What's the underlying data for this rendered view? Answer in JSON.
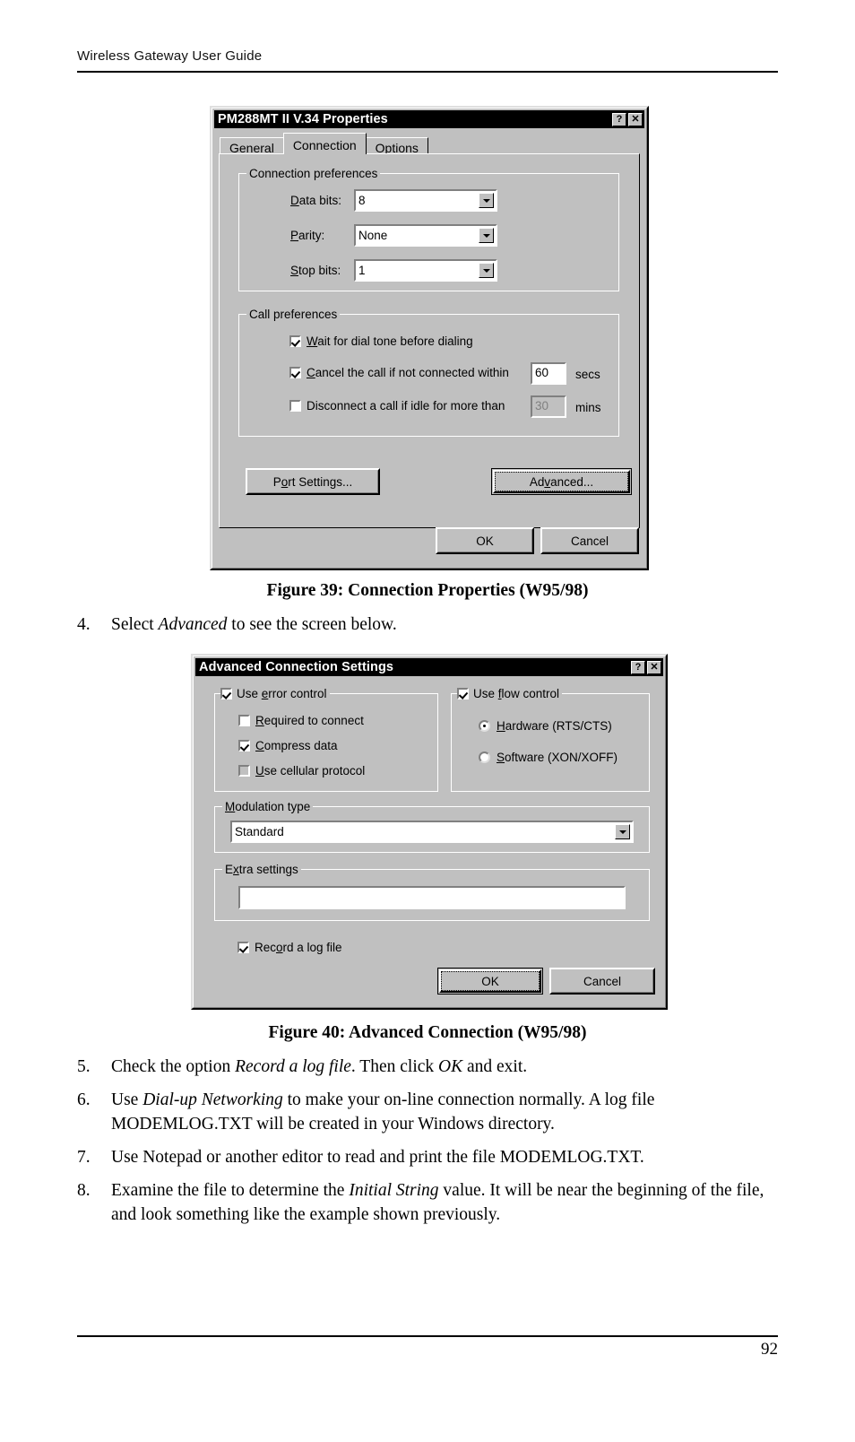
{
  "page": {
    "header": "Wireless Gateway User Guide",
    "number": "92"
  },
  "figure39": {
    "caption": "Figure 39: Connection Properties (W95/98)",
    "dialog": {
      "title": "PM288MT II V.34 Properties",
      "title_buttons": {
        "help": "?",
        "close": "✕"
      },
      "tabs": [
        {
          "label": "General",
          "active": false
        },
        {
          "label": "Connection",
          "active": true
        },
        {
          "label": "Options",
          "active": false
        }
      ],
      "connection_preferences": {
        "title": "Connection preferences",
        "fields": [
          {
            "label_pre": "D",
            "label_post": "ata bits:",
            "value": "8"
          },
          {
            "label_pre": "P",
            "label_post": "arity:",
            "value": "None"
          },
          {
            "label_pre": "S",
            "label_post": "top bits:",
            "value": "1"
          }
        ]
      },
      "call_preferences": {
        "title": "Call preferences",
        "wait": {
          "pre": "W",
          "post": "ait for dial tone before dialing",
          "checked": true
        },
        "cancel": {
          "pre": "C",
          "post": "ancel the call if not connected within",
          "checked": true,
          "value": "60",
          "unit": "secs"
        },
        "disconnect": {
          "pre": "Di",
          "post": "sconnect a call if idle for more than",
          "checked": false,
          "value": "30",
          "unit": "mins"
        }
      },
      "buttons": {
        "port_settings": {
          "pre": "P",
          "mid": "o",
          "post": "rt Settings..."
        },
        "advanced": {
          "pre": "Ad",
          "mid": "v",
          "post": "anced..."
        },
        "ok": "OK",
        "cancel": "Cancel"
      }
    }
  },
  "step4": {
    "num": "4.",
    "pre": "Select ",
    "em": "Advanced",
    "post": " to see the screen below."
  },
  "figure40": {
    "caption": "Figure 40: Advanced Connection (W95/98)",
    "dialog": {
      "title": "Advanced Connection Settings",
      "title_buttons": {
        "help": "?",
        "close": "✕"
      },
      "error_control": {
        "title_pre": "Use ",
        "title_mid": "e",
        "title_post": "rror control",
        "checked": true,
        "options": [
          {
            "pre": "R",
            "post": "equired to connect",
            "checked": false,
            "disabled": false
          },
          {
            "pre": "C",
            "post": "ompress data",
            "checked": true,
            "disabled": false
          },
          {
            "pre": "U",
            "post": "se cellular protocol",
            "checked": false,
            "disabled": true
          }
        ]
      },
      "flow_control": {
        "title_pre": "Use ",
        "title_mid": "f",
        "title_post": "low control",
        "checked": true,
        "options": [
          {
            "pre": "H",
            "post": "ardware (RTS/CTS)",
            "selected": true
          },
          {
            "pre": "S",
            "post": "oftware (XON/XOFF)",
            "selected": false
          }
        ]
      },
      "modulation": {
        "title_pre": "M",
        "title_post": "odulation type",
        "value": "Standard"
      },
      "extra_settings": {
        "title_pre": "E",
        "title_mid": "x",
        "title_post": "tra settings",
        "value": ""
      },
      "record_log": {
        "pre": "Rec",
        "mid": "o",
        "post": "rd a log file",
        "checked": true
      },
      "buttons": {
        "ok": "OK",
        "cancel": "Cancel"
      }
    }
  },
  "steps": [
    {
      "num": "5.",
      "parts": [
        {
          "t": "Check the option ",
          "i": false
        },
        {
          "t": "Record a log file",
          "i": true
        },
        {
          "t": ". Then click ",
          "i": false
        },
        {
          "t": "OK",
          "i": true
        },
        {
          "t": " and exit.",
          "i": false
        }
      ]
    },
    {
      "num": "6.",
      "parts": [
        {
          "t": "Use ",
          "i": false
        },
        {
          "t": "Dial-up Networking",
          "i": true
        },
        {
          "t": " to make your on-line connection normally. A log file MODEMLOG.TXT will be created in your Windows directory.",
          "i": false
        }
      ]
    },
    {
      "num": "7.",
      "parts": [
        {
          "t": "Use Notepad or another editor to read and print the file MODEMLOG.TXT.",
          "i": false
        }
      ]
    },
    {
      "num": "8.",
      "parts": [
        {
          "t": "Examine the file to determine the ",
          "i": false
        },
        {
          "t": "Initial String",
          "i": true
        },
        {
          "t": " value. It will be near the beginning of the file, and look something like the example shown previously.",
          "i": false
        }
      ]
    }
  ]
}
